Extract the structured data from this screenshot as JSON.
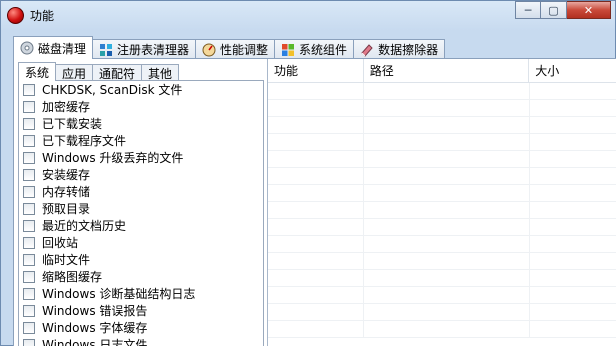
{
  "window": {
    "title": "功能"
  },
  "titlebar_buttons": {
    "minimize": "─",
    "maximize": "▢",
    "close": "✕"
  },
  "main_tabs": [
    {
      "label": "磁盘清理",
      "icon": "disk-icon",
      "active": true
    },
    {
      "label": "注册表清理器",
      "icon": "registry-icon",
      "active": false
    },
    {
      "label": "性能调整",
      "icon": "gauge-icon",
      "active": false
    },
    {
      "label": "系统组件",
      "icon": "windows-icon",
      "active": false
    },
    {
      "label": "数据擦除器",
      "icon": "eraser-icon",
      "active": false
    }
  ],
  "sub_tabs": [
    {
      "label": "系统",
      "active": true
    },
    {
      "label": "应用",
      "active": false
    },
    {
      "label": "通配符",
      "active": false
    },
    {
      "label": "其他",
      "active": false
    }
  ],
  "list_items": [
    "CHKDSK, ScanDisk 文件",
    "加密缓存",
    "已下载安装",
    "已下载程序文件",
    "Windows 升级丢弃的文件",
    "安装缓存",
    "内存转储",
    "预取目录",
    "最近的文档历史",
    "回收站",
    "临时文件",
    "缩略图缓存",
    "Windows 诊断基础结构日志",
    "Windows 错误报告",
    "Windows 字体缓存",
    "Windows 日志文件"
  ],
  "results_table": {
    "columns": [
      "功能",
      "路径",
      "大小"
    ]
  },
  "colors": {
    "close_button": "#c94a3a",
    "frame": "#c7daef"
  }
}
